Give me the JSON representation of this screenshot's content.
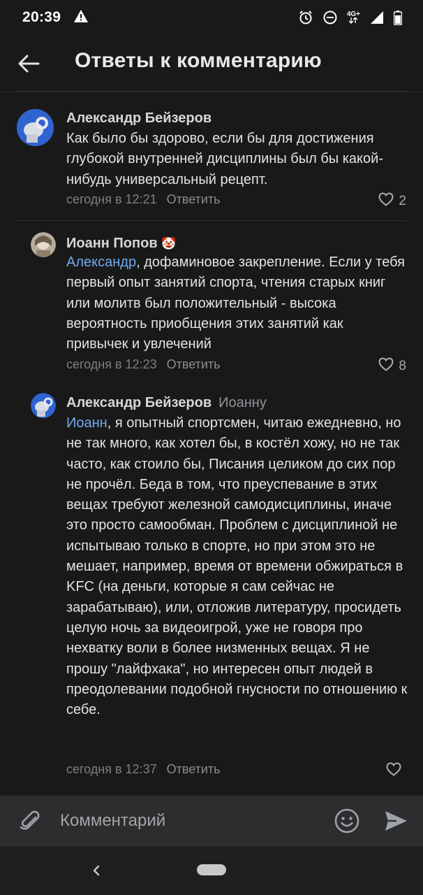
{
  "status_bar": {
    "time": "20:39",
    "network_label": "4G+",
    "icons": [
      "warning-icon",
      "alarm-icon",
      "dnd-icon",
      "signal-icon",
      "battery-icon"
    ]
  },
  "header": {
    "title": "Ответы к комментарию"
  },
  "comments": [
    {
      "author": "Александр Бейзеров",
      "text": "Как было бы здорово, если бы для достижения глубокой внутренней дисциплины был бы какой-нибудь универсальный рецепт.",
      "time": "сегодня в 12:21",
      "reply_label": "Ответить",
      "likes": "2"
    },
    {
      "author": "Иоанн Попов",
      "author_emoji": "🤡",
      "mention": "Александр",
      "text": ", дофаминовое закрепление. Если у тебя первый опыт занятий спорта, чтения старых книг или молитв был положительный - высока вероятность приобщения этих занятий как привычек и увлечений",
      "time": "сегодня в 12:23",
      "reply_label": "Ответить",
      "likes": "8"
    },
    {
      "author": "Александр Бейзеров",
      "reply_to": "Иоанну",
      "mention": "Иоанн",
      "text": ", я опытный спортсмен, читаю ежедневно, но не так много, как хотел бы, в костёл хожу, но не так часто, как стоило бы, Писания целиком до сих пор не прочёл. Беда в том, что преуспевание в этих вещах требуют железной самодисциплины, иначе это просто самообман. Проблем с дисциплиной не испытываю только в спорте, но при этом это не мешает, например, время от времени обжираться в KFC (на деньги, которые я сам сейчас не зарабатываю), или, отложив литературу, просидеть целую ночь за видеоигрой, уже не говоря про нехватку воли в более низменных вещах. Я не прошу \"лайфхака\", но интересен опыт людей в преодолевании подобной гнусности по отношению к себе.",
      "time": "сегодня в 12:37",
      "reply_label": "Ответить",
      "likes": ""
    }
  ],
  "input": {
    "placeholder": "Комментарий"
  },
  "colors": {
    "background": "#19191a",
    "input_bar": "#2c2d2e",
    "mention": "#71aaeb",
    "meta_text": "#7d7f82"
  }
}
